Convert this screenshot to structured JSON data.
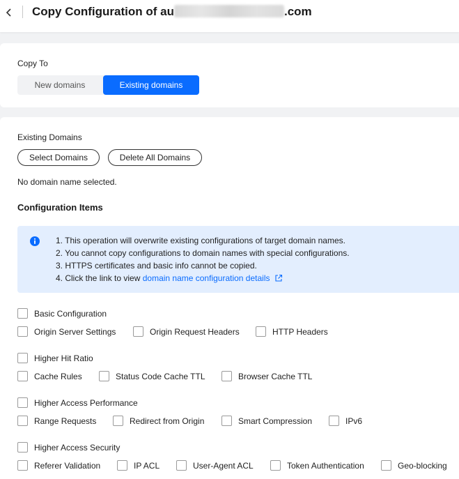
{
  "header": {
    "title_prefix": "Copy Configuration of au",
    "title_suffix": ".com"
  },
  "copy_to": {
    "label": "Copy To",
    "options": [
      "New domains",
      "Existing domains"
    ],
    "selected": "Existing domains"
  },
  "existing_domains": {
    "label": "Existing Domains",
    "select_button": "Select Domains",
    "delete_button": "Delete All Domains",
    "empty_text": "No domain name selected."
  },
  "config": {
    "title": "Configuration Items",
    "notice": {
      "line1": "1. This operation will overwrite existing configurations of target domain names.",
      "line2": "2. You cannot copy configurations to domain names with special configurations.",
      "line3": "3. HTTPS certificates and basic info cannot be copied.",
      "line4_text": "4. Click the link to view ",
      "line4_link": "domain name configuration details"
    },
    "groups": {
      "basic": {
        "label": "Basic Configuration",
        "items": [
          "Origin Server Settings",
          "Origin Request Headers",
          "HTTP Headers"
        ]
      },
      "hit": {
        "label": "Higher Hit Ratio",
        "items": [
          "Cache Rules",
          "Status Code Cache TTL",
          "Browser Cache TTL"
        ]
      },
      "perf": {
        "label": "Higher Access Performance",
        "items": [
          "Range Requests",
          "Redirect from Origin",
          "Smart Compression",
          "IPv6"
        ]
      },
      "security": {
        "label": "Higher Access Security",
        "items": [
          "Referer Validation",
          "IP ACL",
          "User-Agent ACL",
          "Token Authentication",
          "Geo-blocking"
        ]
      }
    }
  },
  "colors": {
    "accent": "#0a6cff",
    "notice_bg": "#e3eefe"
  }
}
